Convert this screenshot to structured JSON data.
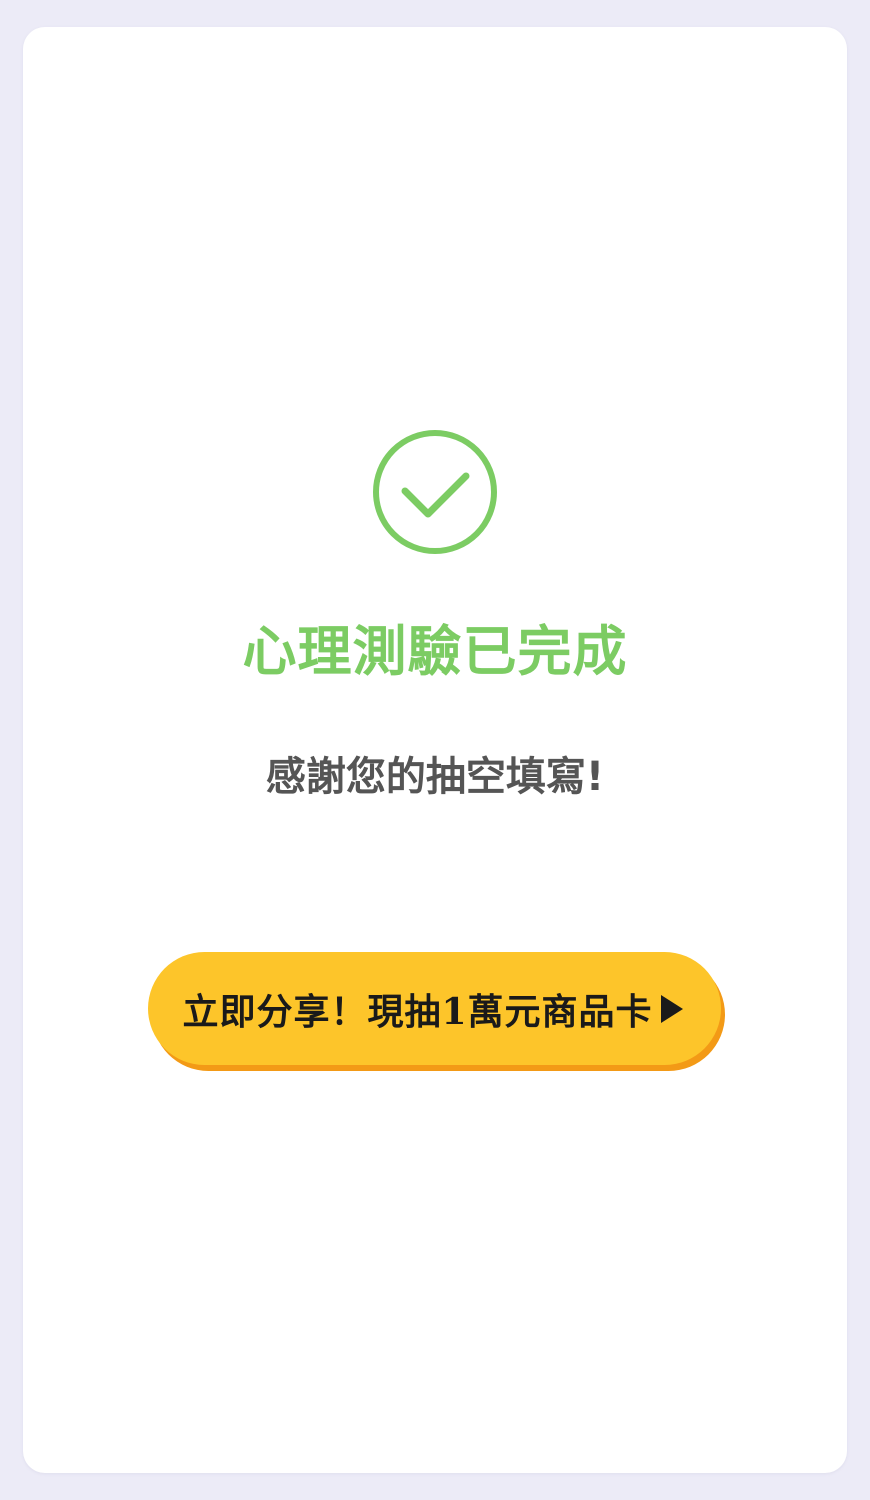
{
  "completion": {
    "icon": "check-circle-icon",
    "title": "心理測驗已完成",
    "message": "感謝您的抽空填寫!"
  },
  "share_button": {
    "label": "立即分享！現抽1萬元商品卡",
    "arrow_icon": "play-arrow-icon"
  },
  "colors": {
    "success_green": "#7ccc63",
    "button_yellow": "#fdc52a",
    "button_shadow_orange": "#f39a16",
    "background": "#ecebf7",
    "message_gray": "#555555"
  }
}
